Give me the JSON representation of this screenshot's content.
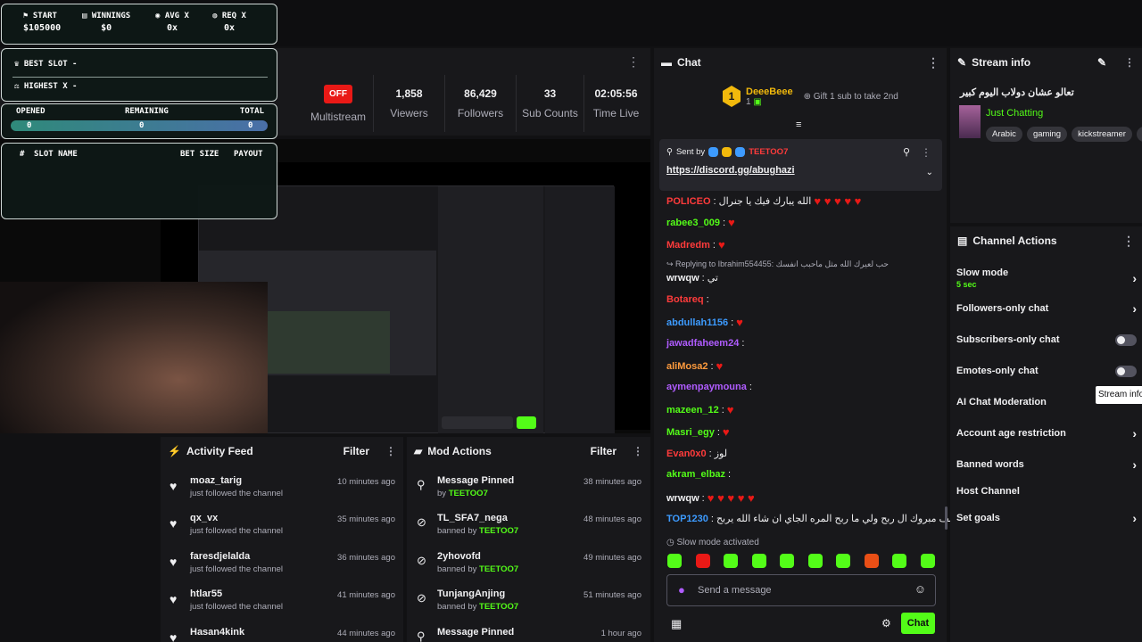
{
  "overlay": {
    "start_label": "START",
    "start_value": "$105000",
    "winnings_label": "WINNINGS",
    "winnings_value": "$0",
    "avg_label": "AVG X",
    "avg_value": "0x",
    "req_label": "REQ X",
    "req_value": "0x",
    "best_slot": "BEST SLOT -",
    "highest_x": "HIGHEST X -",
    "opened_label": "OPENED",
    "remaining_label": "REMAINING",
    "total_label": "TOTAL",
    "opened_value": "0",
    "remaining_value": "0",
    "total_value": "0",
    "col_num": "#",
    "col_slot": "SLOT NAME",
    "col_bet": "BET SIZE",
    "col_payout": "PAYOUT"
  },
  "stats": {
    "multistream_badge": "OFF",
    "multistream_label": "Multistream",
    "viewers_value": "1,858",
    "viewers_label": "Viewers",
    "followers_value": "86,429",
    "followers_label": "Followers",
    "subs_value": "33",
    "subs_label": "Sub Counts",
    "time_value": "02:05:56",
    "time_label": "Time Live"
  },
  "chat": {
    "title": "Chat",
    "top_gifter_rank": "1",
    "top_gifter_name": "DeeeBeee",
    "top_gifter_count": "1",
    "gift_prompt": "Gift 1 sub to take 2nd",
    "pinned_sent_by": "Sent by",
    "pinned_user": "TEETOO7",
    "pinned_link": "https://discord.gg/abughazi",
    "messages": [
      {
        "user": "POLICEO",
        "text": "الله يبارك فيك يا جنرال",
        "color": "#ff3b3b",
        "hearts": "♥ ♥ ♥ ♥ ♥"
      },
      {
        "user": "rabee3_009",
        "text": "",
        "color": "#53fc18",
        "hearts": "♥"
      },
      {
        "user": "Madredm",
        "text": "",
        "color": "#ff3b3b",
        "hearts": "♥"
      },
      {
        "user": "wrwqw",
        "text": "تي",
        "color": "#efeff1",
        "hearts": ""
      },
      {
        "user": "Botareq",
        "text": "",
        "color": "#ff3b3b",
        "hearts": ""
      },
      {
        "user": "abdullah1156",
        "text": "",
        "color": "#3d9bff",
        "hearts": "♥"
      },
      {
        "user": "jawadfaheem24",
        "text": "",
        "color": "#b05cff",
        "hearts": ""
      },
      {
        "user": "aliMosa2",
        "text": "",
        "color": "#ff9b3d",
        "hearts": "♥"
      },
      {
        "user": "aymenpaymouna",
        "text": "",
        "color": "#b05cff",
        "hearts": ""
      },
      {
        "user": "mazeen_12",
        "text": "",
        "color": "#53fc18",
        "hearts": "♥"
      },
      {
        "user": "Masri_egy",
        "text": "",
        "color": "#53fc18",
        "hearts": "♥"
      },
      {
        "user": "Evan0x0",
        "text": "لوز",
        "color": "#ff3b3b",
        "hearts": ""
      },
      {
        "user": "akram_elbaz",
        "text": "",
        "color": "#53fc18",
        "hearts": ""
      },
      {
        "user": "wrwqw",
        "text": "",
        "color": "#efeff1",
        "hearts": "♥ ♥ ♥ ♥ ♥"
      },
      {
        "user": "TOP1230",
        "text": "الف مبروك ال ربح ولي ما ربح المره الجاي ان شاء الله يربح",
        "color": "#3d9bff",
        "hearts": ""
      }
    ],
    "reply_text": "Replying to Ibrahim554455: حب لعيرك الله مثل ماحبب انفسك",
    "slow_mode_notice": "Slow mode activated",
    "input_placeholder": "Send a message",
    "send_label": "Chat"
  },
  "stream_info": {
    "title": "Stream info",
    "stream_title": "تعالو عشان دولاب اليوم كبير",
    "category": "Just Chatting",
    "tags": [
      "Arabic",
      "gaming",
      "kickstreamer",
      "a"
    ]
  },
  "channel_actions": {
    "title": "Channel Actions",
    "slow_mode": "Slow mode",
    "slow_mode_value": "5 sec",
    "followers_only": "Followers-only chat",
    "subscribers_only": "Subscribers-only chat",
    "emotes_only": "Emotes-only chat",
    "tooltip": "Stream info",
    "ai_moderation": "AI Chat Moderation",
    "age_restriction": "Account age restriction",
    "banned_words": "Banned words",
    "host_channel": "Host Channel",
    "set_goals": "Set goals"
  },
  "activity_feed": {
    "title": "Activity Feed",
    "filter": "Filter",
    "items": [
      {
        "name": "moaz_tarig",
        "sub": "just followed the channel",
        "time": "10 minutes ago"
      },
      {
        "name": "qx_vx",
        "sub": "just followed the channel",
        "time": "35 minutes ago"
      },
      {
        "name": "faresdjelalda",
        "sub": "just followed the channel",
        "time": "36 minutes ago"
      },
      {
        "name": "htlar55",
        "sub": "just followed the channel",
        "time": "41 minutes ago"
      },
      {
        "name": "Hasan4kink",
        "sub": "",
        "time": "44 minutes ago"
      }
    ]
  },
  "mod_actions": {
    "title": "Mod Actions",
    "filter": "Filter",
    "items": [
      {
        "name": "Message Pinned",
        "by": "by",
        "mod": "TEETOO7",
        "time": "38 minutes ago"
      },
      {
        "name": "TL_SFA7_nega",
        "by": "banned by",
        "mod": "TEETOO7",
        "time": "48 minutes ago"
      },
      {
        "name": "2yhovofd",
        "by": "banned by",
        "mod": "TEETOO7",
        "time": "49 minutes ago"
      },
      {
        "name": "TunjangAnjing",
        "by": "banned by",
        "mod": "TEETOO7",
        "time": "51 minutes ago"
      },
      {
        "name": "Message Pinned",
        "by": "",
        "mod": "",
        "time": "1 hour ago"
      }
    ]
  }
}
